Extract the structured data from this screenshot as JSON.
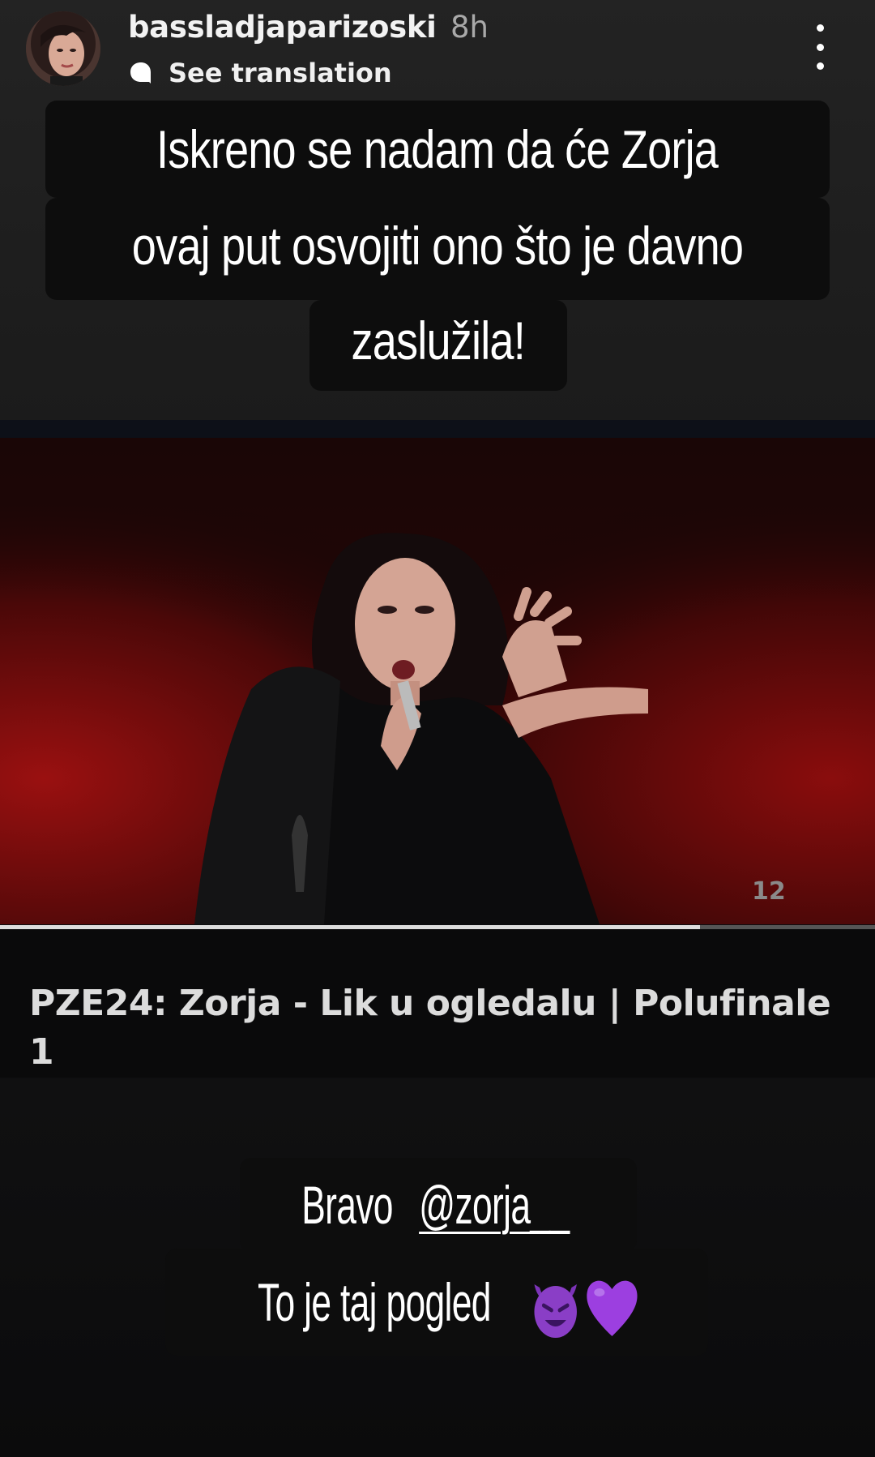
{
  "header": {
    "username": "bassladjaparizoski",
    "time": "8h",
    "translate_label": "See translation"
  },
  "caption_top": {
    "lines": [
      "Iskreno se nadam da će Zorja",
      "ovaj put osvojiti ono što je davno",
      "zaslužila!"
    ]
  },
  "video": {
    "title": "PZE24: Zorja - Lik u ogledalu | Polufinale 1",
    "channel_number": "12",
    "progress": 0.8
  },
  "caption_bottom": {
    "line1_prefix": "Bravo ",
    "mention": "@zorja__",
    "line2": "To je taj pogled"
  },
  "icons": {
    "translate": "translate-icon",
    "more": "more-vertical-icon",
    "devil": "smiling-devil-emoji",
    "heart": "purple-heart-emoji"
  },
  "colors": {
    "accent_purple": "#9c3fe0",
    "devil_purple": "#8a3ec6",
    "stage_red": "#8b0d0d"
  }
}
